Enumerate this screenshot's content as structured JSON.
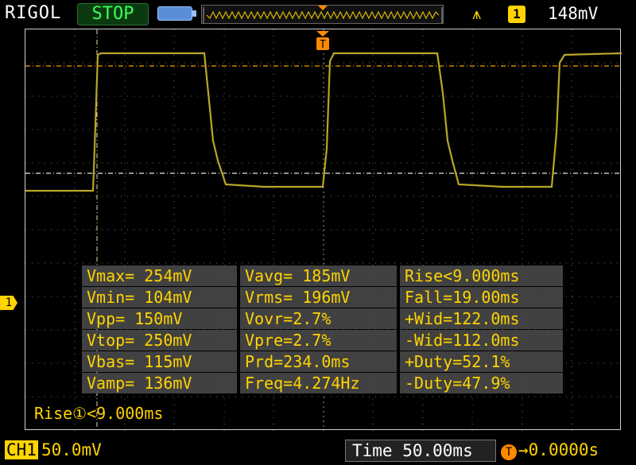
{
  "header": {
    "brand": "RIGOL",
    "run_state": "STOP",
    "trigger": {
      "edge_icon": "rising-edge-icon",
      "channel": "1",
      "level": "148mV"
    }
  },
  "channel_marker": "1",
  "trigger_marker": "T",
  "measurements": [
    [
      "Vmax= 254mV",
      "Vavg= 185mV",
      "Rise<9.000ms"
    ],
    [
      "Vmin= 104mV",
      "Vrms= 196mV",
      "Fall=19.00ms"
    ],
    [
      "Vpp= 150mV",
      "Vovr=2.7%",
      "+Wid=122.0ms"
    ],
    [
      "Vtop= 250mV",
      "Vpre=2.7%",
      "-Wid=112.0ms"
    ],
    [
      "Vbas= 115mV",
      "Prd=234.0ms",
      "+Duty=52.1%"
    ],
    [
      "Vamp= 136mV",
      "Freq=4.274Hz",
      "-Duty=47.9%"
    ]
  ],
  "status_line": "Rise①<9.000ms",
  "footer": {
    "channel_label": "CH1",
    "volts_per_div": "50.0mV",
    "timebase": "Time 50.00ms",
    "trigger_offset": "0.0000s"
  },
  "colors": {
    "trace": "#b9a626",
    "trigger_line": "#f0a000",
    "grid": "#7a7a7a",
    "accent_yellow": "#ffd400",
    "trigger_orange": "#ff8a00"
  }
}
